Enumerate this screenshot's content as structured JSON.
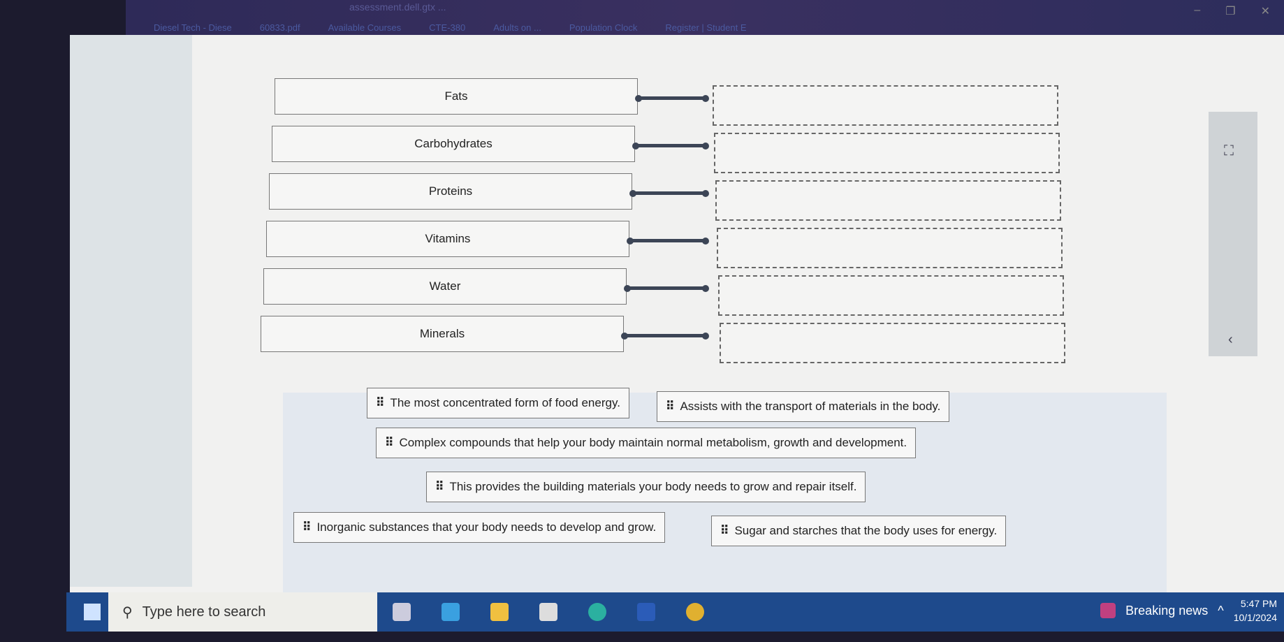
{
  "browser": {
    "url_fragment": "assessment.dell.gtx ...",
    "bookmarks": [
      "Diesel Tech - Diese",
      "60833.pdf",
      "Available Courses",
      "CTE-380",
      "Adults on ...",
      "Population Clock",
      "Register | Student E"
    ]
  },
  "matching": {
    "terms": [
      "Fats",
      "Carbohydrates",
      "Proteins",
      "Vitamins",
      "Water",
      "Minerals"
    ],
    "options": [
      "The most concentrated form of food energy.",
      "Assists with the transport of materials in the body.",
      "Complex compounds that help your body maintain normal metabolism, growth and development.",
      "This provides the building materials your body needs to grow and repair itself.",
      "Inorganic substances that your body needs to develop and grow.",
      "Sugar and starches that the body uses for energy."
    ]
  },
  "sidebar": {
    "expand_icon": "fullscreen-icon",
    "collapse_icon": "chevron-left-icon"
  },
  "taskbar": {
    "search_placeholder": "Type here to search",
    "news": "Breaking news",
    "time": "5:47 PM",
    "date": "10/1/2024"
  }
}
